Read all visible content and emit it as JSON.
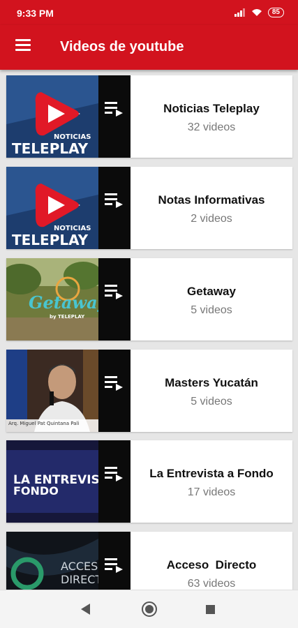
{
  "status_bar": {
    "time": "9:33 PM",
    "battery": "85"
  },
  "app_bar": {
    "title": "Videos de youtube"
  },
  "playlists": [
    {
      "title": "Noticias Teleplay",
      "count": "32 videos",
      "thumb_text_1": "NOTICIAS",
      "thumb_text_2": "TELEPLAY"
    },
    {
      "title": "Notas Informativas",
      "count": "2 videos",
      "thumb_text_1": "NOTICIAS",
      "thumb_text_2": "TELEPLAY"
    },
    {
      "title": "Getaway",
      "count": "5 videos",
      "thumb_text_1": "Getaway",
      "thumb_text_2": "by TELEPLAY"
    },
    {
      "title": "Masters Yucatán",
      "count": "5 videos",
      "thumb_text_1": "Arq. Miguel Pat Quintana Pali"
    },
    {
      "title": "La Entrevista a Fondo",
      "count": "17 videos",
      "thumb_text_1": "LA ENTREVISTA",
      "thumb_text_2": "FONDO"
    },
    {
      "title": "Acceso  Directo",
      "count": "63 videos",
      "thumb_text_1": "ACCESO",
      "thumb_text_2": "DIRECTO"
    }
  ]
}
